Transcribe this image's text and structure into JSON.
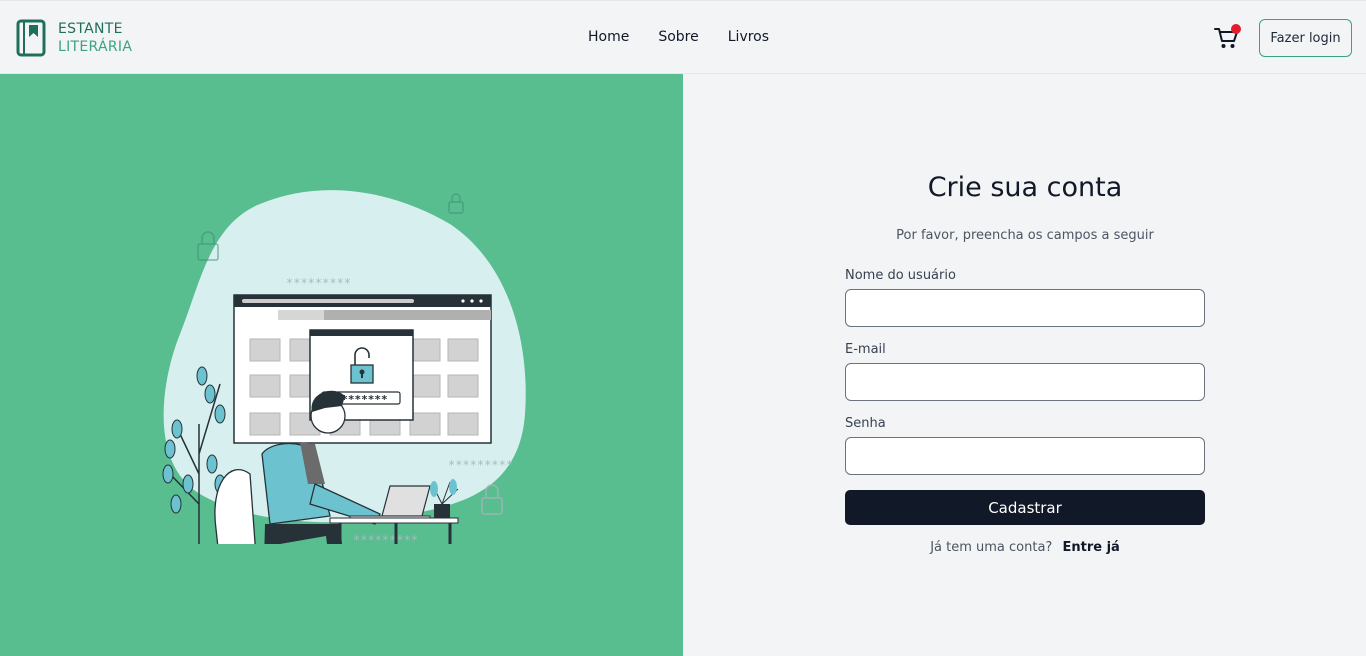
{
  "header": {
    "logo": {
      "line1": "ESTANTE",
      "line2": "LITERÁRIA"
    },
    "nav": [
      {
        "label": "Home"
      },
      {
        "label": "Sobre"
      },
      {
        "label": "Livros"
      }
    ],
    "login_label": "Fazer login",
    "cart_has_items": true
  },
  "illustration": {
    "password_mask": "*********",
    "icons": [
      "lock-icon",
      "folder-icon",
      "laptop-icon",
      "plant-icon"
    ]
  },
  "form": {
    "title": "Crie sua conta",
    "subtitle": "Por favor, preencha os campos a seguir",
    "fields": [
      {
        "label": "Nome do usuário",
        "value": ""
      },
      {
        "label": "E-mail",
        "value": ""
      },
      {
        "label": "Senha",
        "value": ""
      }
    ],
    "submit_label": "Cadastrar",
    "footer_text": "Já tem uma conta?",
    "footer_link": "Entre já"
  },
  "colors": {
    "brand_green": "#58bd8f",
    "dark": "#111827",
    "accent_red": "#e11d2e"
  }
}
